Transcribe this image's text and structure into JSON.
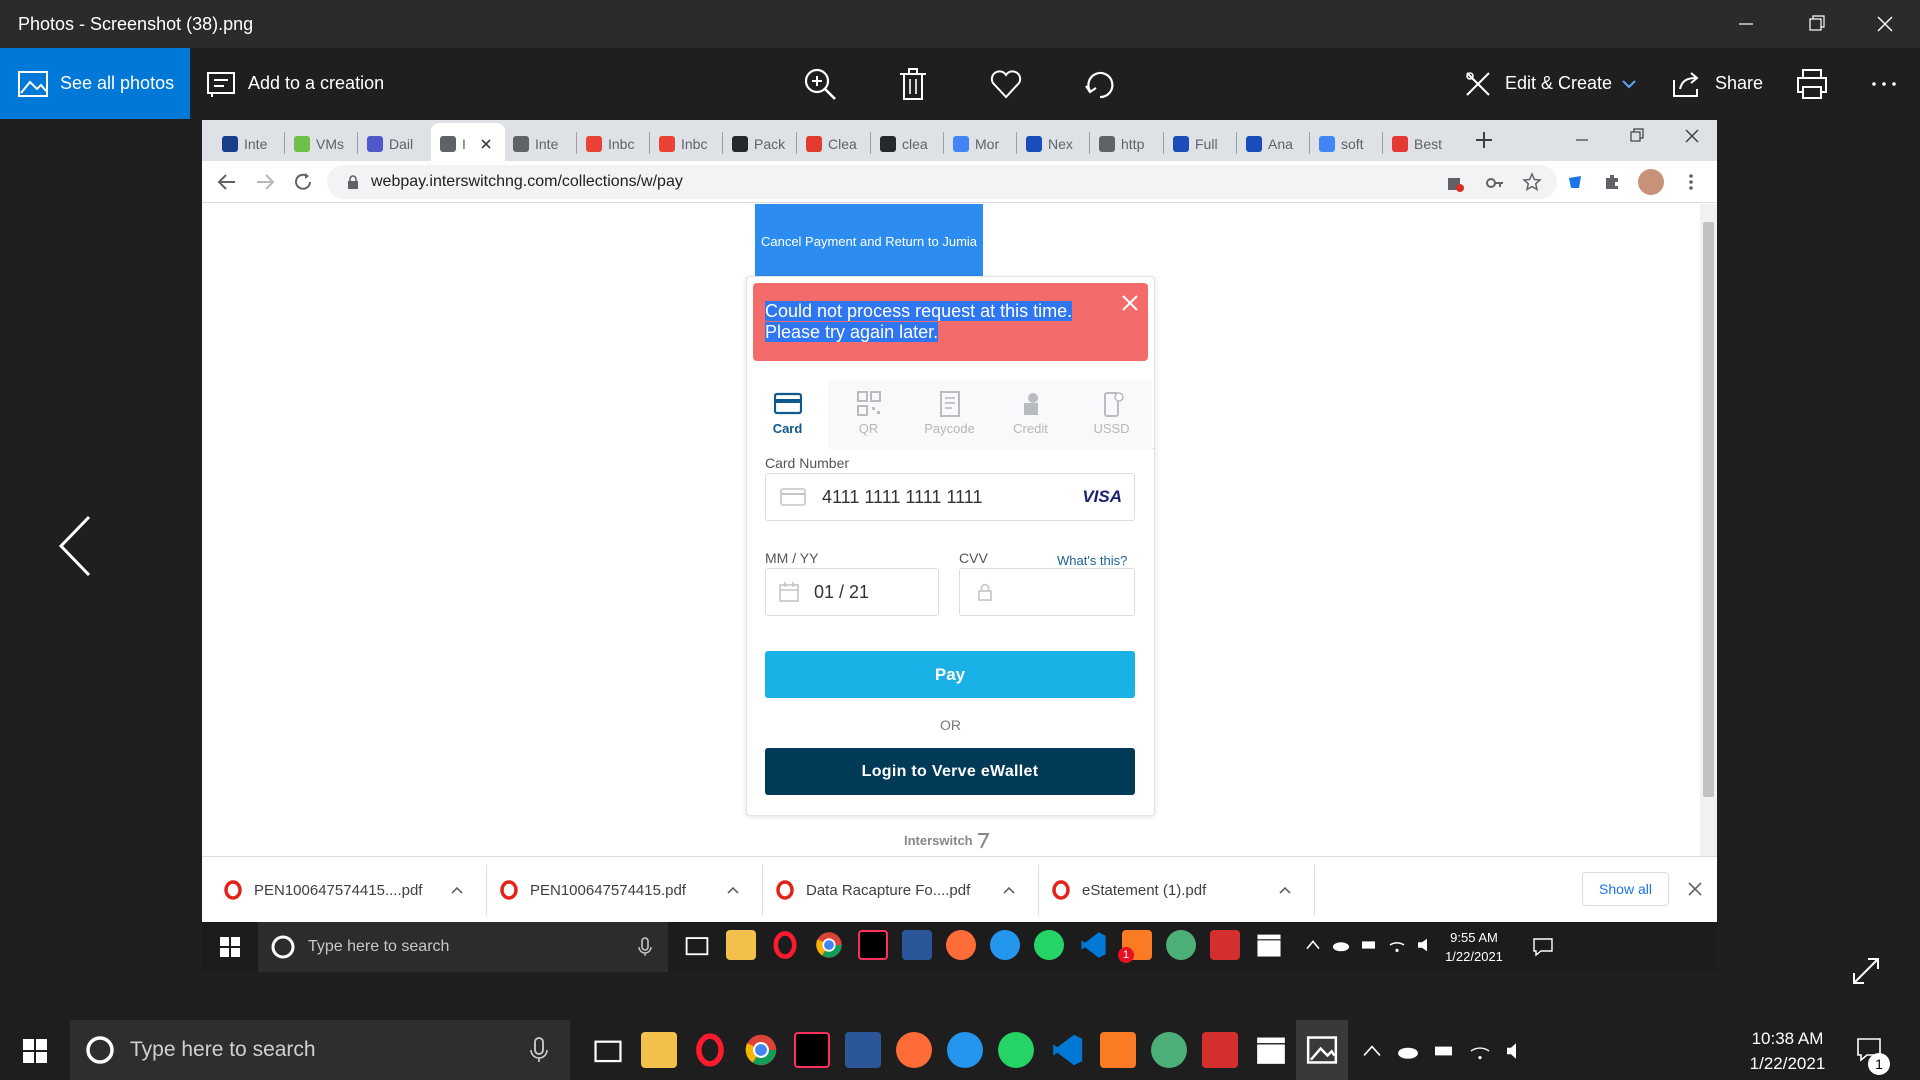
{
  "app": {
    "title": "Photos - Screenshot (38).png",
    "toolbar": {
      "see_all_label": "See all photos",
      "add_creation_label": "Add to a creation",
      "edit_create_label": "Edit & Create",
      "share_label": "Share"
    }
  },
  "browser": {
    "tabs": [
      {
        "label": "Inte",
        "color": "#1a3e8a"
      },
      {
        "label": "VMs",
        "color": "#6cc04a"
      },
      {
        "label": "Dail",
        "color": "#5059c9"
      },
      {
        "label": "I",
        "color": "#5f6368"
      },
      {
        "label": "Inte",
        "color": "#5f6368"
      },
      {
        "label": "Inbc",
        "color": "#ea4335"
      },
      {
        "label": "Inbc",
        "color": "#ea4335"
      },
      {
        "label": "Pack",
        "color": "#24292e"
      },
      {
        "label": "Clea",
        "color": "#e03b2e"
      },
      {
        "label": "clea",
        "color": "#24292e"
      },
      {
        "label": "Mor",
        "color": "#4285f4"
      },
      {
        "label": "Nex",
        "color": "#1a4cbb"
      },
      {
        "label": "http",
        "color": "#5f6368"
      },
      {
        "label": "Full",
        "color": "#1a4cbb"
      },
      {
        "label": "Ana",
        "color": "#1a4cbb"
      },
      {
        "label": "soft",
        "color": "#4285f4"
      },
      {
        "label": "Best",
        "color": "#e53935"
      }
    ],
    "url": "webpay.interswitchng.com/collections/w/pay"
  },
  "payment": {
    "cancel_label": "Cancel Payment and Return to Jumia",
    "error_line1": "Could not process request at this time.",
    "error_line2": "Please try again later.",
    "methods": [
      {
        "label": "Card"
      },
      {
        "label": "QR"
      },
      {
        "label": "Paycode"
      },
      {
        "label": "Credit"
      },
      {
        "label": "USSD"
      }
    ],
    "card_number_label": "Card Number",
    "card_number_value": "4111 1111 1111 1111",
    "card_brand": "VISA",
    "expiry_label": "MM / YY",
    "expiry_value": "01 / 21",
    "cvv_label": "CVV",
    "cvv_help": "What's this?",
    "pay_label": "Pay",
    "or_label": "OR",
    "verve_label": "Login to Verve eWallet",
    "footer_brand": "Interswitch"
  },
  "downloads": {
    "items": [
      {
        "name": "PEN100647574415....pdf"
      },
      {
        "name": "PEN100647574415.pdf"
      },
      {
        "name": "Data Racapture Fo....pdf"
      },
      {
        "name": "eStatement (1).pdf"
      }
    ],
    "show_all_label": "Show all"
  },
  "inner_taskbar": {
    "search_placeholder": "Type here to search",
    "time": "9:55 AM",
    "date": "1/22/2021",
    "whatsapp_badge": "1"
  },
  "taskbar": {
    "search_placeholder": "Type here to search",
    "time": "10:38 AM",
    "date": "1/22/2021",
    "notification_count": "1"
  }
}
